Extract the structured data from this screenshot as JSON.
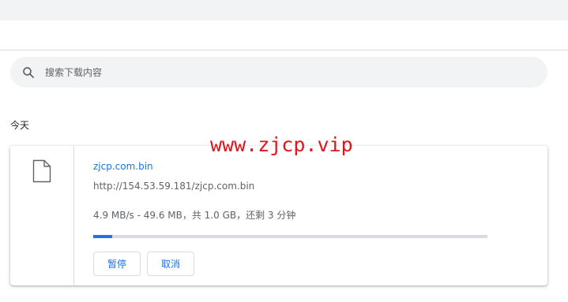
{
  "search": {
    "placeholder": "搜索下载内容"
  },
  "section": {
    "title": "今天"
  },
  "watermark": "www.zjcp.vip",
  "download": {
    "file_name": "zjcp.com.bin",
    "url": "http://154.53.59.181/zjcp.com.bin",
    "status": "4.9 MB/s - 49.6 MB，共 1.0 GB，还剩 3 分钟",
    "progress_fraction": 0.0484,
    "pause_label": "暂停",
    "cancel_label": "取消"
  },
  "colors": {
    "accent": "#1a73e8",
    "watermark": "#e1141b",
    "progress_track": "#dadce0"
  },
  "icons": {
    "search": "search-icon",
    "file": "file-icon"
  }
}
